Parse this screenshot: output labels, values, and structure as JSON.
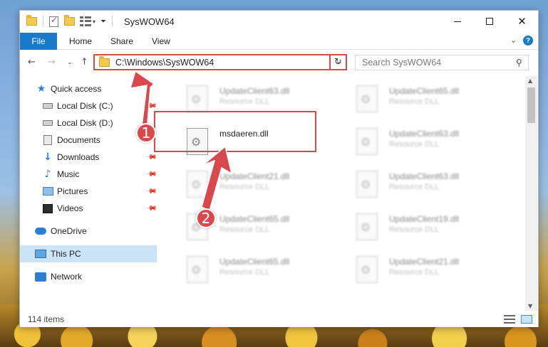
{
  "window": {
    "title": "SysWOW64",
    "minimize_label": "Minimize",
    "maximize_label": "Maximize",
    "close_label": "Close"
  },
  "ribbon": {
    "tabs": [
      "File",
      "Home",
      "Share",
      "View"
    ]
  },
  "address_bar": {
    "path": "C:\\Windows\\SysWOW64"
  },
  "search": {
    "placeholder": "Search SysWOW64"
  },
  "sidebar": {
    "items": [
      {
        "label": "Quick access",
        "icon": "star-icon",
        "pinned": false
      },
      {
        "label": "Local Disk (C:)",
        "icon": "disk-icon",
        "pinned": true
      },
      {
        "label": "Local Disk (D:)",
        "icon": "disk-icon",
        "pinned": false
      },
      {
        "label": "Documents",
        "icon": "documents-icon",
        "pinned": false
      },
      {
        "label": "Downloads",
        "icon": "downloads-icon",
        "pinned": true
      },
      {
        "label": "Music",
        "icon": "music-icon",
        "pinned": true
      },
      {
        "label": "Pictures",
        "icon": "pictures-icon",
        "pinned": true
      },
      {
        "label": "Videos",
        "icon": "videos-icon",
        "pinned": true
      },
      {
        "label": "OneDrive",
        "icon": "onedrive-icon",
        "pinned": false
      },
      {
        "label": "This PC",
        "icon": "this-pc-icon",
        "pinned": false,
        "selected": true
      },
      {
        "label": "Network",
        "icon": "network-icon",
        "pinned": false
      }
    ]
  },
  "files": [
    {
      "name": "UpdateClient63.dll",
      "type": "Resource DLL",
      "blurred": true
    },
    {
      "name": "UpdateClient65.dll",
      "type": "Resource DLL",
      "blurred": true
    },
    {
      "name": "msdaeren.dll",
      "type": "",
      "blurred": false,
      "highlighted": true
    },
    {
      "name": "UpdateClient63.dll",
      "type": "Resource DLL",
      "blurred": true
    },
    {
      "name": "UpdateClient21.dll",
      "type": "Resource DLL",
      "blurred": true
    },
    {
      "name": "UpdateClient63.dll",
      "type": "Resource DLL",
      "blurred": true
    },
    {
      "name": "UpdateClient65.dll",
      "type": "Resource DLL",
      "blurred": true
    },
    {
      "name": "UpdateClient19.dll",
      "type": "Resource DLL",
      "blurred": true
    },
    {
      "name": "UpdateClient65.dll",
      "type": "Resource DLL",
      "blurred": true
    },
    {
      "name": "UpdateClient21.dll",
      "type": "Resource DLL",
      "blurred": true
    }
  ],
  "status": {
    "item_count": "114 items"
  },
  "annotations": {
    "step1": "1",
    "step2": "2",
    "color": "#d9484c"
  },
  "colors": {
    "accent": "#1979ca",
    "selection": "#cce4f7",
    "highlight": "#d9484c"
  }
}
